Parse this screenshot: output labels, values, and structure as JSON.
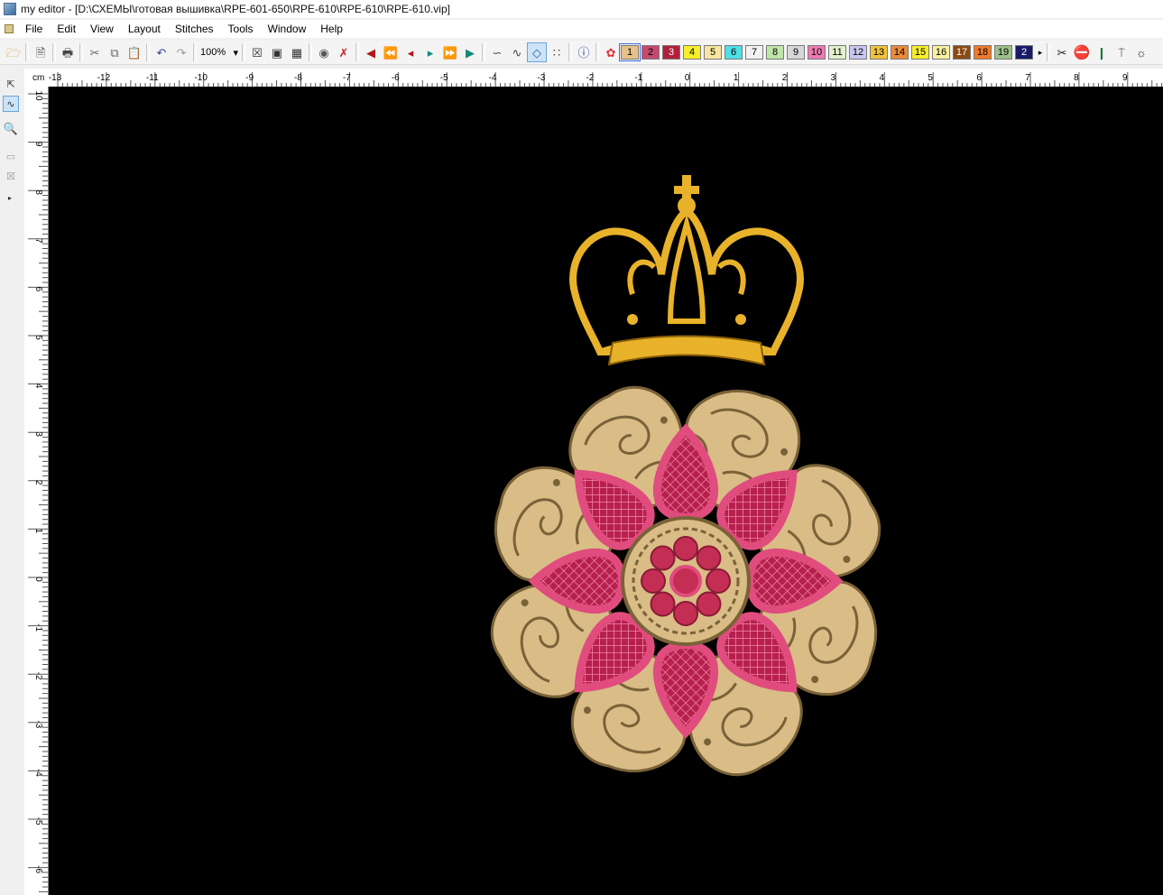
{
  "window": {
    "title": "my editor - [D:\\СХЕМЫ\\готовая вышивка\\RPE-601-650\\RPE-610\\RPE-610\\RPE-610.vip]"
  },
  "menu": [
    "File",
    "Edit",
    "View",
    "Layout",
    "Stitches",
    "Tools",
    "Window",
    "Help"
  ],
  "toolbar": {
    "zoom": "100%",
    "icons": [
      "open-folder-icon",
      "open-file-icon",
      "print-icon",
      "cut-icon",
      "copy-icon",
      "paste-icon",
      "undo-icon",
      "redo-icon",
      "fit-design-icon",
      "fit-selection-icon",
      "fit-page-icon",
      "show-stitches-icon",
      "hide-stitches-icon",
      "first-stitch-icon",
      "previous-color-icon",
      "previous-stitch-icon",
      "next-stitch-icon",
      "next-color-icon",
      "last-stitch-icon",
      "curve-tool-icon",
      "zigzag-tool-icon",
      "select-tool-icon",
      "dots-tool-icon",
      "info-icon",
      "color-wheel-icon",
      "scissors-icon",
      "stop-icon",
      "needle-icon",
      "trim-icon"
    ],
    "colors": [
      {
        "label": "1",
        "color": "#e8c08a"
      },
      {
        "label": "2",
        "color": "#c44b6e"
      },
      {
        "label": "3",
        "color": "#b0203c"
      },
      {
        "label": "4",
        "color": "#f6ee2a"
      },
      {
        "label": "5",
        "color": "#f8e6a0"
      },
      {
        "label": "6",
        "color": "#4fe0e6"
      },
      {
        "label": "7",
        "color": "#f2f2f2"
      },
      {
        "label": "8",
        "color": "#bfe6a8"
      },
      {
        "label": "9",
        "color": "#d7d7d7"
      },
      {
        "label": "10",
        "color": "#f07ab0"
      },
      {
        "label": "11",
        "color": "#e2f0cc"
      },
      {
        "label": "12",
        "color": "#c8c8ee"
      },
      {
        "label": "13",
        "color": "#f2c23a"
      },
      {
        "label": "14",
        "color": "#e88a3a"
      },
      {
        "label": "15",
        "color": "#f6ee2a"
      },
      {
        "label": "16",
        "color": "#f8f0a0"
      },
      {
        "label": "17",
        "color": "#8a4a14"
      },
      {
        "label": "18",
        "color": "#f07a2a"
      },
      {
        "label": "19",
        "color": "#9ec08a"
      },
      {
        "label": "2",
        "color": "#1a1a6a"
      }
    ],
    "selected_color_index": 0
  },
  "ruler": {
    "unit": "cm",
    "h_labels": [
      "-13",
      "-12",
      "-11",
      "-10",
      "-9",
      "-8",
      "-7",
      "-6",
      "-5",
      "-4",
      "-3",
      "-2",
      "-1",
      "0",
      "1",
      "2",
      "3",
      "4",
      "5",
      "6",
      "7",
      "8",
      "9"
    ],
    "v_labels": [
      "10",
      "9",
      "8",
      "7",
      "6",
      "5",
      "4",
      "3",
      "2",
      "1",
      "0",
      "-1",
      "-2",
      "-3",
      "-4",
      "-5",
      "-6"
    ]
  },
  "tools_left": [
    "select-icon",
    "stitch-edit-icon",
    "zoom-icon",
    "transform-icon",
    "resize-icon"
  ],
  "design": {
    "thread_colors": {
      "crown": "#e8b22a",
      "crown_dark": "#8a5f08",
      "lace": "#d9bc86",
      "lace_dark": "#7a6238",
      "petal": "#d94f7a",
      "center": "#c42e55",
      "leaf": "#38e028"
    }
  }
}
